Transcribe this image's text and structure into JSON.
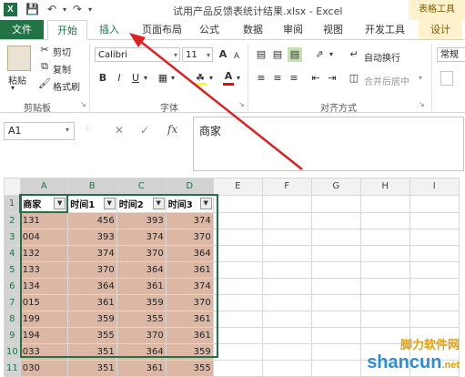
{
  "titlebar": {
    "app_logo": "X",
    "window_title": "试用产品反馈表统计结果.xlsx - Excel",
    "table_tools": "表格工具",
    "qa_icons": [
      "save-icon",
      "undo-icon",
      "redo-icon"
    ]
  },
  "tabs": {
    "file": "文件",
    "home": "开始",
    "insert": "插入",
    "page_layout": "页面布局",
    "formulas": "公式",
    "data": "数据",
    "review": "审阅",
    "view": "视图",
    "developer": "开发工具",
    "design": "设计"
  },
  "ribbon": {
    "clipboard": {
      "paste": "粘贴",
      "cut": "剪切",
      "copy": "复制",
      "format_painter": "格式刷",
      "label": "剪贴板"
    },
    "font": {
      "font_name": "Calibri",
      "font_size": "11",
      "label": "字体",
      "bold": "B",
      "italic": "I",
      "underline": "U",
      "grow": "A",
      "shrink": "A",
      "font_color": "A"
    },
    "alignment": {
      "wrap_text": "自动换行",
      "merge_center": "合并后居中",
      "label": "对齐方式"
    },
    "number": {
      "format": "常规"
    }
  },
  "formula_bar": {
    "name_box": "A1",
    "cancel_icon": "✕",
    "enter_icon": "✓",
    "fx": "fx",
    "content": "商家"
  },
  "sheet": {
    "columns": [
      "A",
      "B",
      "C",
      "D",
      "E",
      "F",
      "G",
      "H",
      "I"
    ],
    "headers": [
      "商家",
      "时间1",
      "时间2",
      "时间3"
    ],
    "rows": [
      [
        "131",
        "456",
        "393",
        "374"
      ],
      [
        "004",
        "393",
        "374",
        "370"
      ],
      [
        "132",
        "374",
        "370",
        "364"
      ],
      [
        "133",
        "370",
        "364",
        "361"
      ],
      [
        "134",
        "364",
        "361",
        "374"
      ],
      [
        "015",
        "361",
        "359",
        "370"
      ],
      [
        "199",
        "359",
        "355",
        "361"
      ],
      [
        "194",
        "355",
        "370",
        "361"
      ],
      [
        "033",
        "351",
        "364",
        "359"
      ],
      [
        "030",
        "351",
        "361",
        "355"
      ]
    ]
  },
  "watermark": {
    "top": "脚力软件网",
    "bottom": "shancun",
    "suffix": ".net"
  }
}
